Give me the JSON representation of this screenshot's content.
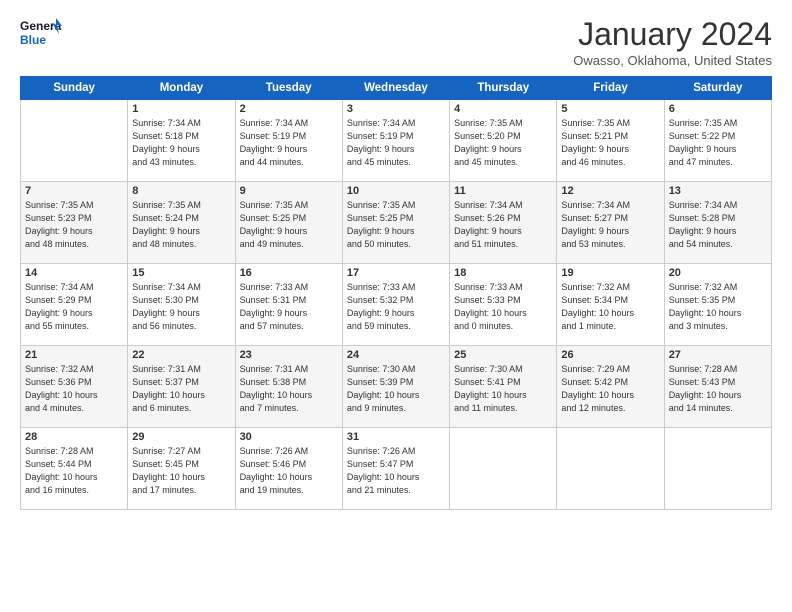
{
  "logo": {
    "line1": "General",
    "line2": "Blue"
  },
  "title": "January 2024",
  "location": "Owasso, Oklahoma, United States",
  "days_header": [
    "Sunday",
    "Monday",
    "Tuesday",
    "Wednesday",
    "Thursday",
    "Friday",
    "Saturday"
  ],
  "weeks": [
    [
      {
        "day": "",
        "text": ""
      },
      {
        "day": "1",
        "text": "Sunrise: 7:34 AM\nSunset: 5:18 PM\nDaylight: 9 hours\nand 43 minutes."
      },
      {
        "day": "2",
        "text": "Sunrise: 7:34 AM\nSunset: 5:19 PM\nDaylight: 9 hours\nand 44 minutes."
      },
      {
        "day": "3",
        "text": "Sunrise: 7:34 AM\nSunset: 5:19 PM\nDaylight: 9 hours\nand 45 minutes."
      },
      {
        "day": "4",
        "text": "Sunrise: 7:35 AM\nSunset: 5:20 PM\nDaylight: 9 hours\nand 45 minutes."
      },
      {
        "day": "5",
        "text": "Sunrise: 7:35 AM\nSunset: 5:21 PM\nDaylight: 9 hours\nand 46 minutes."
      },
      {
        "day": "6",
        "text": "Sunrise: 7:35 AM\nSunset: 5:22 PM\nDaylight: 9 hours\nand 47 minutes."
      }
    ],
    [
      {
        "day": "7",
        "text": "Sunrise: 7:35 AM\nSunset: 5:23 PM\nDaylight: 9 hours\nand 48 minutes."
      },
      {
        "day": "8",
        "text": "Sunrise: 7:35 AM\nSunset: 5:24 PM\nDaylight: 9 hours\nand 48 minutes."
      },
      {
        "day": "9",
        "text": "Sunrise: 7:35 AM\nSunset: 5:25 PM\nDaylight: 9 hours\nand 49 minutes."
      },
      {
        "day": "10",
        "text": "Sunrise: 7:35 AM\nSunset: 5:25 PM\nDaylight: 9 hours\nand 50 minutes."
      },
      {
        "day": "11",
        "text": "Sunrise: 7:34 AM\nSunset: 5:26 PM\nDaylight: 9 hours\nand 51 minutes."
      },
      {
        "day": "12",
        "text": "Sunrise: 7:34 AM\nSunset: 5:27 PM\nDaylight: 9 hours\nand 53 minutes."
      },
      {
        "day": "13",
        "text": "Sunrise: 7:34 AM\nSunset: 5:28 PM\nDaylight: 9 hours\nand 54 minutes."
      }
    ],
    [
      {
        "day": "14",
        "text": "Sunrise: 7:34 AM\nSunset: 5:29 PM\nDaylight: 9 hours\nand 55 minutes."
      },
      {
        "day": "15",
        "text": "Sunrise: 7:34 AM\nSunset: 5:30 PM\nDaylight: 9 hours\nand 56 minutes."
      },
      {
        "day": "16",
        "text": "Sunrise: 7:33 AM\nSunset: 5:31 PM\nDaylight: 9 hours\nand 57 minutes."
      },
      {
        "day": "17",
        "text": "Sunrise: 7:33 AM\nSunset: 5:32 PM\nDaylight: 9 hours\nand 59 minutes."
      },
      {
        "day": "18",
        "text": "Sunrise: 7:33 AM\nSunset: 5:33 PM\nDaylight: 10 hours\nand 0 minutes."
      },
      {
        "day": "19",
        "text": "Sunrise: 7:32 AM\nSunset: 5:34 PM\nDaylight: 10 hours\nand 1 minute."
      },
      {
        "day": "20",
        "text": "Sunrise: 7:32 AM\nSunset: 5:35 PM\nDaylight: 10 hours\nand 3 minutes."
      }
    ],
    [
      {
        "day": "21",
        "text": "Sunrise: 7:32 AM\nSunset: 5:36 PM\nDaylight: 10 hours\nand 4 minutes."
      },
      {
        "day": "22",
        "text": "Sunrise: 7:31 AM\nSunset: 5:37 PM\nDaylight: 10 hours\nand 6 minutes."
      },
      {
        "day": "23",
        "text": "Sunrise: 7:31 AM\nSunset: 5:38 PM\nDaylight: 10 hours\nand 7 minutes."
      },
      {
        "day": "24",
        "text": "Sunrise: 7:30 AM\nSunset: 5:39 PM\nDaylight: 10 hours\nand 9 minutes."
      },
      {
        "day": "25",
        "text": "Sunrise: 7:30 AM\nSunset: 5:41 PM\nDaylight: 10 hours\nand 11 minutes."
      },
      {
        "day": "26",
        "text": "Sunrise: 7:29 AM\nSunset: 5:42 PM\nDaylight: 10 hours\nand 12 minutes."
      },
      {
        "day": "27",
        "text": "Sunrise: 7:28 AM\nSunset: 5:43 PM\nDaylight: 10 hours\nand 14 minutes."
      }
    ],
    [
      {
        "day": "28",
        "text": "Sunrise: 7:28 AM\nSunset: 5:44 PM\nDaylight: 10 hours\nand 16 minutes."
      },
      {
        "day": "29",
        "text": "Sunrise: 7:27 AM\nSunset: 5:45 PM\nDaylight: 10 hours\nand 17 minutes."
      },
      {
        "day": "30",
        "text": "Sunrise: 7:26 AM\nSunset: 5:46 PM\nDaylight: 10 hours\nand 19 minutes."
      },
      {
        "day": "31",
        "text": "Sunrise: 7:26 AM\nSunset: 5:47 PM\nDaylight: 10 hours\nand 21 minutes."
      },
      {
        "day": "",
        "text": ""
      },
      {
        "day": "",
        "text": ""
      },
      {
        "day": "",
        "text": ""
      }
    ]
  ]
}
